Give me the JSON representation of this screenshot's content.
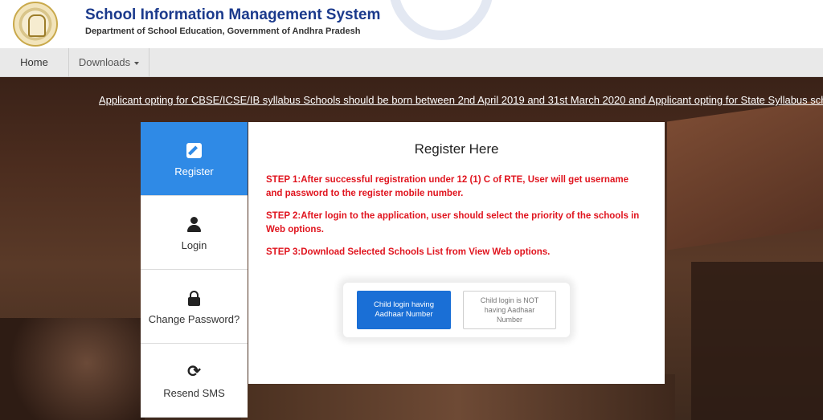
{
  "header": {
    "title": "School Information Management System",
    "subtitle": "Department of School Education, Government of Andhra Pradesh"
  },
  "nav": {
    "home": "Home",
    "downloads": "Downloads"
  },
  "notice": "Applicant opting for CBSE/ICSE/IB syllabus Schools should be born between 2nd April 2019 and 31st March 2020 and Applicant opting for State Syllabus schools",
  "sidebar": {
    "items": [
      {
        "label": "Register",
        "icon": "pencil-square-icon"
      },
      {
        "label": "Login",
        "icon": "user-icon"
      },
      {
        "label": "Change Password?",
        "icon": "lock-icon"
      },
      {
        "label": "Resend SMS",
        "icon": "refresh-icon"
      }
    ]
  },
  "panel": {
    "title": "Register Here",
    "steps": [
      "STEP 1:After successful registration under 12 (1) C of RTE, User will get username and password to the register mobile number.",
      "STEP 2:After login to the application, user should select the priority of the schools in Web options.",
      "STEP 3:Download Selected Schools List from View Web options."
    ],
    "buttons": {
      "with_aadhaar": "Child login having Aadhaar Number",
      "without_aadhaar": "Child login is NOT having Aadhaar Number"
    }
  },
  "colors": {
    "brand_title": "#1b3a8c",
    "active_tab": "#2f8ae6",
    "step_text": "#e0141e",
    "primary_button": "#1a6fd6"
  }
}
